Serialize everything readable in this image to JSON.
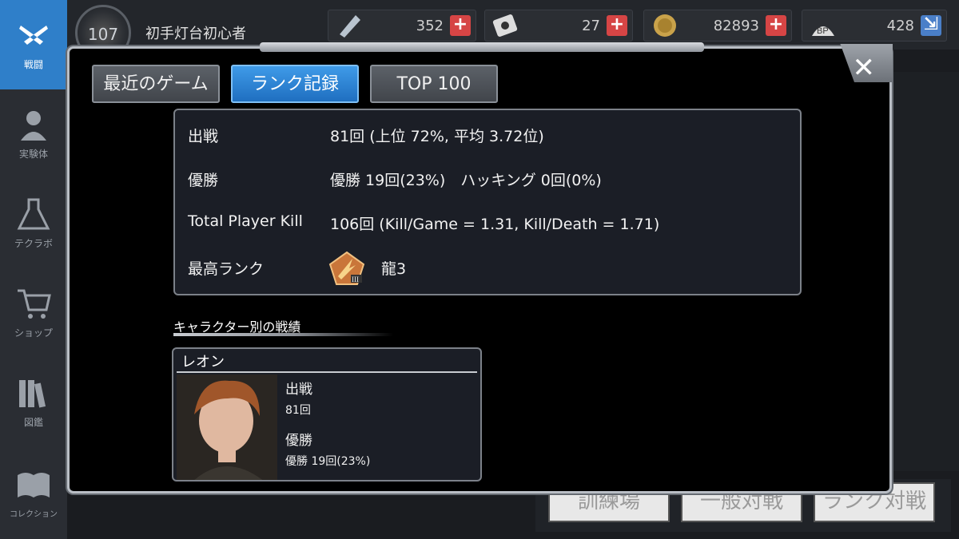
{
  "sidebar": {
    "items": [
      {
        "label": "戦闘",
        "icon": "crossed-guns-icon",
        "active": true
      },
      {
        "label": "実験体",
        "icon": "character-icon",
        "active": false
      },
      {
        "label": "テクラボ",
        "icon": "flask-icon",
        "active": false
      },
      {
        "label": "ショップ",
        "icon": "cart-icon",
        "active": false
      },
      {
        "label": "図鑑",
        "icon": "books-icon",
        "active": false
      },
      {
        "label": "コレクション",
        "icon": "open-book-icon",
        "active": false
      }
    ]
  },
  "player": {
    "level": "107",
    "name": "初手灯台初心者"
  },
  "resources": [
    {
      "icon": "crystal-icon",
      "value": "352"
    },
    {
      "icon": "disk-icon",
      "value": "27"
    },
    {
      "icon": "coin-icon",
      "value": "82893"
    },
    {
      "icon": "bp-paw-icon",
      "value": "428"
    }
  ],
  "background_buttons": [
    "訓練場",
    "一般対戦",
    "ランク対戦"
  ],
  "modal": {
    "tabs": [
      {
        "label": "最近のゲーム",
        "active": false
      },
      {
        "label": "ランク記録",
        "active": true
      },
      {
        "label": "TOP 100",
        "active": false
      }
    ],
    "stats": {
      "sortie_label": "出戦",
      "sortie_value": "81回 (上位 72%, 平均 3.72位)",
      "win_label": "優勝",
      "win_value": "優勝 19回(23%)　ハッキング 0回(0%)",
      "kill_label": "Total Player Kill",
      "kill_value": "106回 (Kill/Game = 1.31, Kill/Death = 1.71)",
      "rank_label": "最高ランク",
      "rank_value": "龍3",
      "rank_icon": "dragon-rank-badge-icon"
    },
    "section_title": "キャラクター別の戦績",
    "character": {
      "name": "レオン",
      "sortie_label": "出戦",
      "sortie_value": "81回",
      "win_label": "優勝",
      "win_value": "優勝 19回(23%)"
    }
  },
  "colors": {
    "accent": "#2f7fc9",
    "plus": "#d64545",
    "panel": "#1b1e26"
  }
}
